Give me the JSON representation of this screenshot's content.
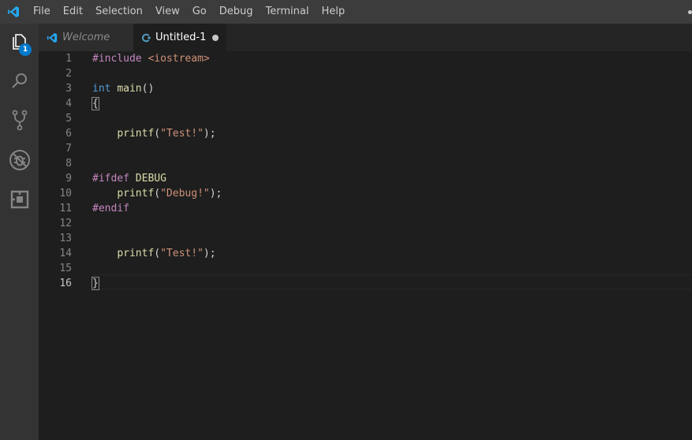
{
  "menu": {
    "items": [
      "File",
      "Edit",
      "Selection",
      "View",
      "Go",
      "Debug",
      "Terminal",
      "Help"
    ]
  },
  "activity": {
    "explorer_badge": "1",
    "icons": [
      "files-icon",
      "search-icon",
      "source-control-icon",
      "debug-icon",
      "extensions-icon"
    ]
  },
  "tabs": [
    {
      "label": "Welcome",
      "active": false
    },
    {
      "label": "Untitled-1",
      "active": true,
      "dirty": true
    }
  ],
  "editor": {
    "line_numbers": [
      "1",
      "2",
      "3",
      "4",
      "5",
      "6",
      "7",
      "8",
      "9",
      "10",
      "11",
      "12",
      "13",
      "14",
      "15",
      "16"
    ],
    "current_line": "16",
    "lines": [
      [
        {
          "t": "#include ",
          "c": "pre"
        },
        {
          "t": "<iostream>",
          "c": "str"
        }
      ],
      [],
      [
        {
          "t": "int ",
          "c": "kw"
        },
        {
          "t": "main",
          "c": "fn"
        },
        {
          "t": "()",
          "c": "plain"
        }
      ],
      [
        {
          "t": "{",
          "c": "plain"
        }
      ],
      [],
      [
        {
          "t": "    ",
          "c": "plain"
        },
        {
          "t": "printf",
          "c": "fn"
        },
        {
          "t": "(",
          "c": "plain"
        },
        {
          "t": "\"Test!\"",
          "c": "str"
        },
        {
          "t": ");",
          "c": "plain"
        }
      ],
      [],
      [],
      [
        {
          "t": "#ifdef ",
          "c": "pre"
        },
        {
          "t": "DEBUG",
          "c": "macro"
        }
      ],
      [
        {
          "t": "    ",
          "c": "plain"
        },
        {
          "t": "printf",
          "c": "fn"
        },
        {
          "t": "(",
          "c": "plain"
        },
        {
          "t": "\"Debug!\"",
          "c": "str"
        },
        {
          "t": ");",
          "c": "plain"
        }
      ],
      [
        {
          "t": "#endif",
          "c": "pre"
        }
      ],
      [],
      [],
      [
        {
          "t": "    ",
          "c": "plain"
        },
        {
          "t": "printf",
          "c": "fn"
        },
        {
          "t": "(",
          "c": "plain"
        },
        {
          "t": "\"Test!\"",
          "c": "str"
        },
        {
          "t": ");",
          "c": "plain"
        }
      ],
      [],
      [
        {
          "t": "}",
          "c": "plain"
        }
      ]
    ]
  },
  "colors": {
    "accent": "#007acc",
    "editor_bg": "#1e1e1e",
    "activity_bg": "#333333",
    "title_bg": "#3c3c3c"
  }
}
